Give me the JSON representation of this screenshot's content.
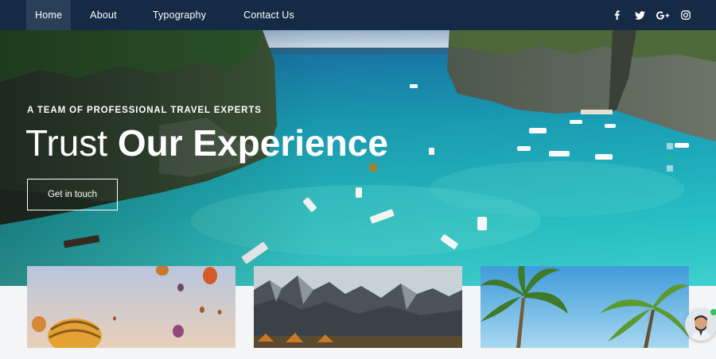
{
  "nav": {
    "items": [
      {
        "label": "Home",
        "active": true
      },
      {
        "label": "About"
      },
      {
        "label": "Typography"
      },
      {
        "label": "Contact Us"
      }
    ],
    "socials": [
      {
        "icon": "facebook-icon",
        "glyph": "f"
      },
      {
        "icon": "twitter-icon",
        "glyph": "t"
      },
      {
        "icon": "google-plus-icon",
        "glyph": "G+"
      },
      {
        "icon": "instagram-icon",
        "glyph": ""
      }
    ]
  },
  "hero": {
    "subtitle": "A TEAM OF PROFESSIONAL TRAVEL EXPERTS",
    "title_light": "Trust",
    "title_bold": "Our Experience",
    "button_label": "Get in touch",
    "slide_count": 3,
    "active_slide": 2
  },
  "colors": {
    "nav_bg": "#152b45",
    "nav_active": "#2b4058",
    "accent": "#1fb0a7",
    "sea": "#1a9fb6"
  },
  "cards": [
    {
      "name": "hot-air-balloons-card"
    },
    {
      "name": "mountains-card"
    },
    {
      "name": "palm-trees-card"
    }
  ]
}
